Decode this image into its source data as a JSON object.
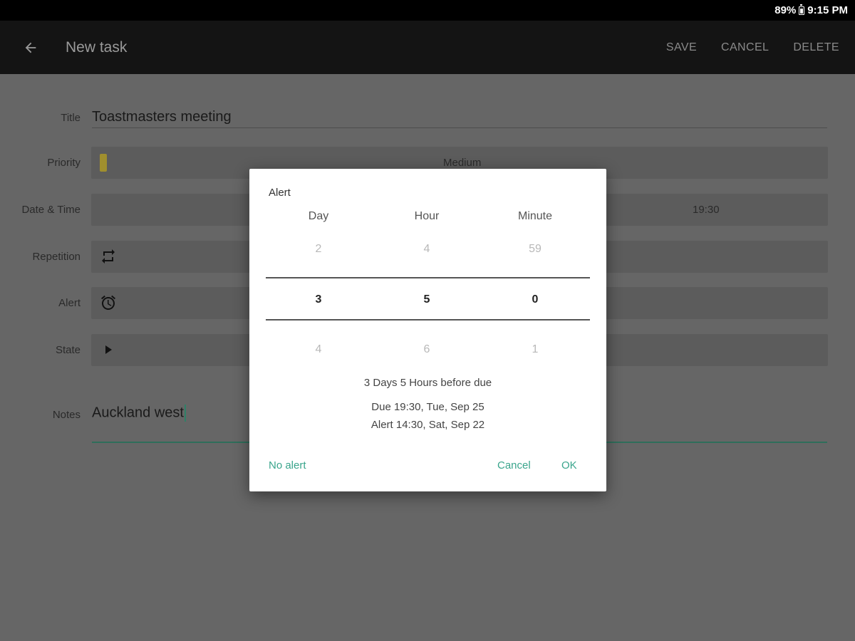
{
  "status_bar": {
    "battery": "89%",
    "time": "9:15 PM"
  },
  "app_bar": {
    "title": "New task",
    "actions": {
      "save": "SAVE",
      "cancel": "CANCEL",
      "delete": "DELETE"
    }
  },
  "form": {
    "title": {
      "label": "Title",
      "value": "Toastmasters meeting"
    },
    "priority": {
      "label": "Priority",
      "value": "Medium",
      "marker_color": "#a08f2e"
    },
    "datetime": {
      "label": "Date & Time",
      "time": "19:30"
    },
    "repetition": {
      "label": "Repetition",
      "icon": "repeat-icon"
    },
    "alert": {
      "label": "Alert",
      "icon": "alarm-clock-icon"
    },
    "state": {
      "label": "State",
      "icon": "play-icon"
    },
    "notes": {
      "label": "Notes",
      "value": "Auckland west"
    }
  },
  "dialog": {
    "title": "Alert",
    "columns": [
      {
        "header": "Day",
        "above": "2",
        "selected": "3",
        "below": "4"
      },
      {
        "header": "Hour",
        "above": "4",
        "selected": "5",
        "below": "6"
      },
      {
        "header": "Minute",
        "above": "59",
        "selected": "0",
        "below": "1"
      }
    ],
    "summary": "3 Days 5 Hours before due",
    "due": "Due 19:30, Tue, Sep 25",
    "alert": "Alert 14:30, Sat, Sep 22",
    "buttons": {
      "no_alert": "No alert",
      "cancel": "Cancel",
      "ok": "OK"
    },
    "accent_color": "#3aa58c"
  }
}
